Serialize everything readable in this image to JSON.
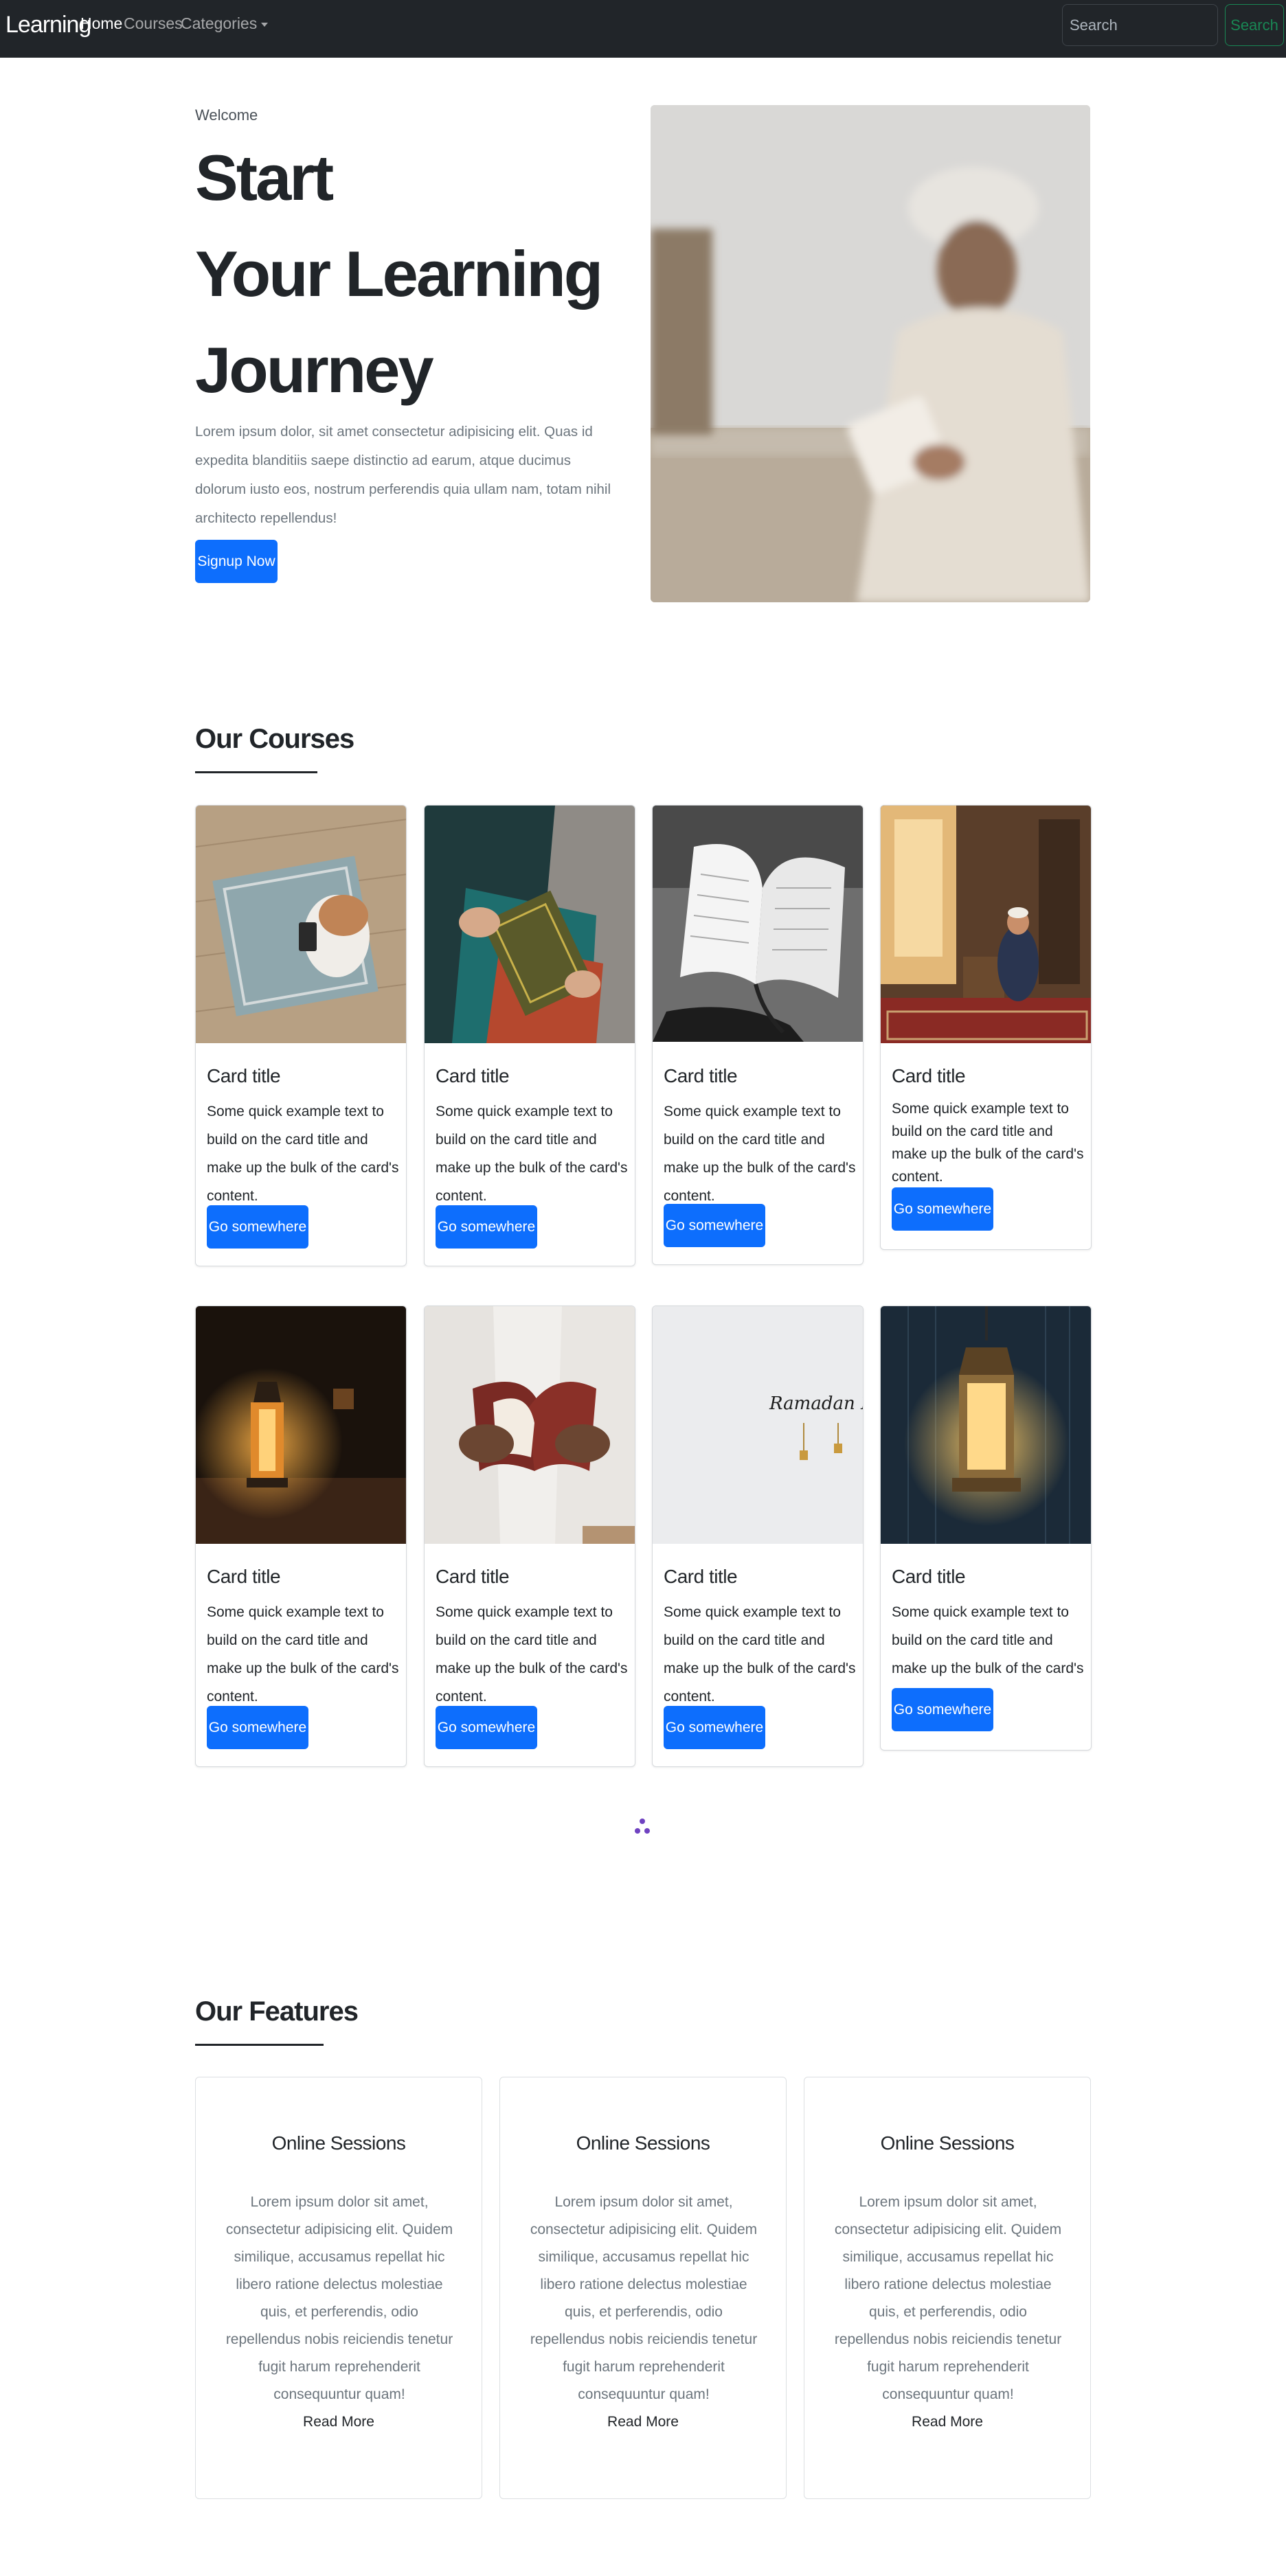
{
  "navbar": {
    "brand": "Learning",
    "links": [
      "Home",
      "Courses",
      "Categories"
    ],
    "search_placeholder": "Search",
    "search_button": "Search"
  },
  "hero": {
    "eyebrow": "Welcome",
    "title_lines": [
      "Start",
      "Your Learning",
      "Journey"
    ],
    "text": "Lorem ipsum dolor, sit amet consectetur adipisicing elit. Quas id expedita blanditiis saepe distinctio ad earum, atque ducimus dolorum iusto eos, nostrum perferendis quia ullam nam, totam nihil architecto repellendus!",
    "cta": "Signup Now",
    "image_subject": "man-reading-book-photo"
  },
  "courses": {
    "heading": "Our Courses",
    "cards": [
      {
        "title": "Card title",
        "text": "Some quick example text to build on the card title and make up the bulk of the card's content.",
        "button": "Go somewhere",
        "image": "prayer-rug-photo"
      },
      {
        "title": "Card title",
        "text": "Some quick example text to build on the card title and make up the bulk of the card's content.",
        "button": "Go somewhere",
        "image": "quran-reading-photo"
      },
      {
        "title": "Card title",
        "text": "Some quick example text to build on the card title and make up the bulk of the card's content.",
        "button": "Go somewhere",
        "image": "open-book-photo"
      },
      {
        "title": "Card title",
        "text": "Some quick example text to build on the card title and make up the bulk of the card's content.",
        "button": "Go somewhere",
        "image": "mosque-prayer-photo"
      },
      {
        "title": "Card title",
        "text": "Some quick example text to build on the card title and make up the bulk of the card's content.",
        "button": "Go somewhere",
        "image": "lantern-photo"
      },
      {
        "title": "Card title",
        "text": "Some quick example text to build on the card title and make up the bulk of the card's content.",
        "button": "Go somewhere",
        "image": "hands-holding-book-photo"
      },
      {
        "title": "Card title",
        "text": "Some quick example text to build on the card title and make up the bulk of the card's content.",
        "button": "Go somewhere",
        "image": "ramadan-mubarak-photo",
        "image_caption": "Ramadan Mubarak"
      },
      {
        "title": "Card title",
        "text": "Some quick example text to build on the card title and make up the bulk of the card's content.",
        "button": "Go somewhere",
        "image": "glowing-lantern-photo"
      }
    ]
  },
  "features": {
    "heading": "Our Features",
    "cards": [
      {
        "title": "Online Sessions",
        "text": "Lorem ipsum dolor sit amet, consectetur adipisicing elit. Quidem similique, accusamus repellat hic libero ratione delectus molestiae quis, et perferendis, odio repellendus nobis reiciendis tenetur fugit harum reprehenderit consequuntur quam!",
        "link": "Read More"
      },
      {
        "title": "Online Sessions",
        "text": "Lorem ipsum dolor sit amet, consectetur adipisicing elit. Quidem similique, accusamus repellat hic libero ratione delectus molestiae quis, et perferendis, odio repellendus nobis reiciendis tenetur fugit harum reprehenderit consequuntur quam!",
        "link": "Read More"
      },
      {
        "title": "Online Sessions",
        "text": "Lorem ipsum dolor sit amet, consectetur adipisicing elit. Quidem similique, accusamus repellat hic libero ratione delectus molestiae quis, et perferendis, odio repellendus nobis reiciendis tenetur fugit harum reprehenderit consequuntur quam!",
        "link": "Read More"
      }
    ]
  },
  "colors": {
    "navbar": "#212529",
    "primary": "#0d6efd",
    "success": "#198754",
    "loader": "#6f42c1"
  }
}
